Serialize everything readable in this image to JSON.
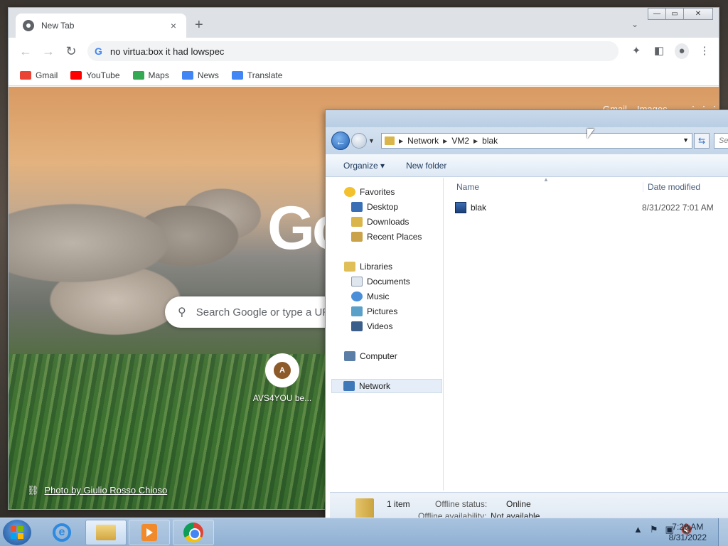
{
  "chrome": {
    "tab_title": "New Tab",
    "tab_close": "×",
    "newtab": "+",
    "tab_dropdown": "⌄",
    "win_min": "—",
    "win_max": "▭",
    "win_close": "✕",
    "back": "←",
    "forward": "→",
    "reload": "↻",
    "omnibox_value": "no virtua:box it had lowspec",
    "bookmarks": [
      {
        "label": "Gmail",
        "color": "#ea4335"
      },
      {
        "label": "YouTube",
        "color": "#ff0000"
      },
      {
        "label": "Maps",
        "color": "#34a853"
      },
      {
        "label": "News",
        "color": "#4285f4"
      },
      {
        "label": "Translate",
        "color": "#4285f4"
      }
    ],
    "ntp": {
      "gmail": "Gmail",
      "images": "Images",
      "logo_text": "Go",
      "search_placeholder": "Search Google or type a URL",
      "shortcut_letter": "A",
      "shortcut_label": "AVS4YOU be...",
      "photo_credit": "Photo by Giulio Rosso Chioso"
    }
  },
  "explorer": {
    "breadcrumb": [
      "Network",
      "VM2",
      "blak"
    ],
    "search_placeholder": "Se",
    "commands": {
      "organize": "Organize ▾",
      "new_folder": "New folder"
    },
    "nav": {
      "favorites": "Favorites",
      "desktop": "Desktop",
      "downloads": "Downloads",
      "recent": "Recent Places",
      "libraries": "Libraries",
      "documents": "Documents",
      "music": "Music",
      "pictures": "Pictures",
      "videos": "Videos",
      "computer": "Computer",
      "network": "Network"
    },
    "columns": {
      "name": "Name",
      "date": "Date modified"
    },
    "files": [
      {
        "name": "blak",
        "date": "8/31/2022 7:01 AM"
      }
    ],
    "details": {
      "count": "1 item",
      "offline_status_label": "Offline status:",
      "offline_status_value": "Online",
      "offline_avail_label": "Offline availability:",
      "offline_avail_value": "Not available"
    }
  },
  "taskbar": {
    "time": "7:29 AM",
    "date": "8/31/2022",
    "tray_up": "▲"
  }
}
